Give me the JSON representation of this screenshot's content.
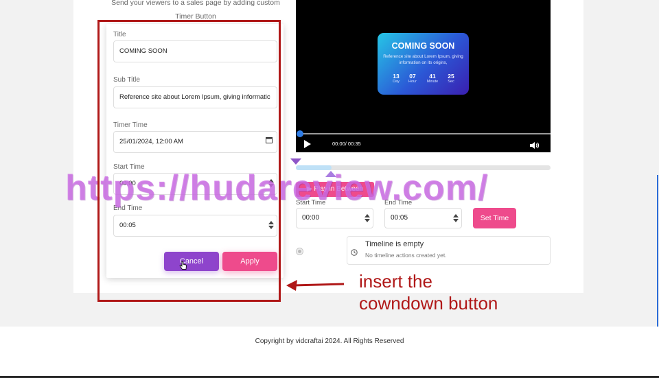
{
  "intro_text": "Send your viewers to a sales page by adding custom Timer Button",
  "form": {
    "title_label": "Title",
    "title_value": "COMING SOON",
    "subtitle_label": "Sub Title",
    "subtitle_value": "Reference site about Lorem Ipsum, giving informatic",
    "timer_label": "Timer Time",
    "timer_value": "25/01/2024, 12:00  AM",
    "start_label": "Start Time",
    "start_value": "00:00",
    "end_label": "End Time",
    "end_value": "00:05",
    "cancel_label": "Cancel",
    "apply_label": "Apply"
  },
  "video": {
    "overlay_title": "COMING SOON",
    "overlay_subtitle": "Reference site about Lorem Ipsum, giving information on its origins,",
    "countdown": [
      {
        "value": "13",
        "unit": "Day"
      },
      {
        "value": "07",
        "unit": "Hour"
      },
      {
        "value": "41",
        "unit": "Minute"
      },
      {
        "value": "25",
        "unit": "Sec"
      }
    ],
    "time_display": "00:00/ 00:35",
    "progress": 0.0
  },
  "timeline": {
    "play_between_label": "▶ Play in Between",
    "start_label": "Start Time",
    "start_value": "00:00",
    "end_label": "End Time",
    "end_value": "00:05",
    "set_time_label": "Set Time",
    "empty_title": "Timeline is empty",
    "empty_subtitle": "No timeline actions created yet."
  },
  "watermark": "https://hudareview.com/",
  "annotation": {
    "line1": "insert the",
    "line2": "cowndown button"
  },
  "footer": "Copyright by vidcraftai 2024. All Rights Reserved",
  "colors": {
    "accent_pink": "#ee4b8c",
    "accent_purple": "#8e44cc",
    "annotation_red": "#b01818",
    "progress_blue": "#2f7de6"
  }
}
